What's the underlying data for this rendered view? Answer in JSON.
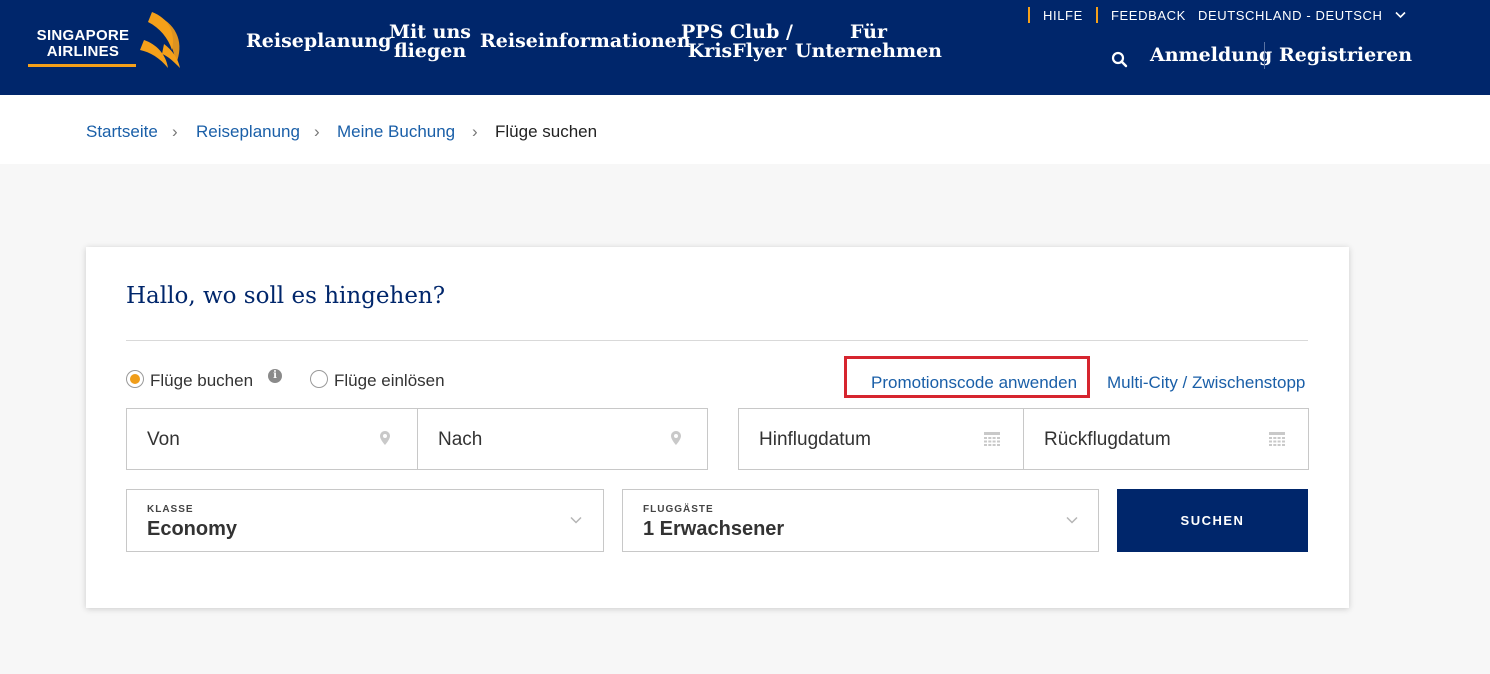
{
  "header": {
    "logo": {
      "line1": "SINGAPORE",
      "line2": "AIRLINES"
    },
    "nav": [
      {
        "line1": "Reiseplanung",
        "line2": ""
      },
      {
        "line1": "Mit uns",
        "line2": "fliegen"
      },
      {
        "line1": "Reiseinformationen",
        "line2": ""
      },
      {
        "line1": "PPS Club /",
        "line2": "KrisFlyer"
      },
      {
        "line1": "Für",
        "line2": "Unternehmen"
      }
    ],
    "utility": {
      "help": "HILFE",
      "feedback": "FEEDBACK",
      "locale": "DEUTSCHLAND - DEUTSCH"
    },
    "auth": {
      "login": "Anmeldung",
      "register": "Registrieren"
    }
  },
  "breadcrumb": {
    "items": [
      "Startseite",
      "Reiseplanung",
      "Meine Buchung"
    ],
    "current": "Flüge suchen",
    "separator": "›"
  },
  "booking": {
    "title": "Hallo, wo soll es hingehen?",
    "options": [
      {
        "label": "Flüge buchen",
        "selected": true
      },
      {
        "label": "Flüge einlösen",
        "selected": false
      }
    ],
    "info_glyph": "i",
    "promo_link": "Promotionscode anwenden",
    "multicity_link": "Multi-City / Zwischenstopp",
    "from_placeholder": "Von",
    "to_placeholder": "Nach",
    "depart_placeholder": "Hinflugdatum",
    "return_placeholder": "Rückflugdatum",
    "class": {
      "label": "KLASSE",
      "value": "Economy"
    },
    "passengers": {
      "label": "FLUGGÄSTE",
      "value": "1 Erwachsener"
    },
    "search_button": "SUCHEN"
  },
  "colors": {
    "brand_navy": "#00266b",
    "accent_gold": "#f09d19",
    "link_blue": "#1a5fa8",
    "highlight_red": "#d6252f"
  }
}
